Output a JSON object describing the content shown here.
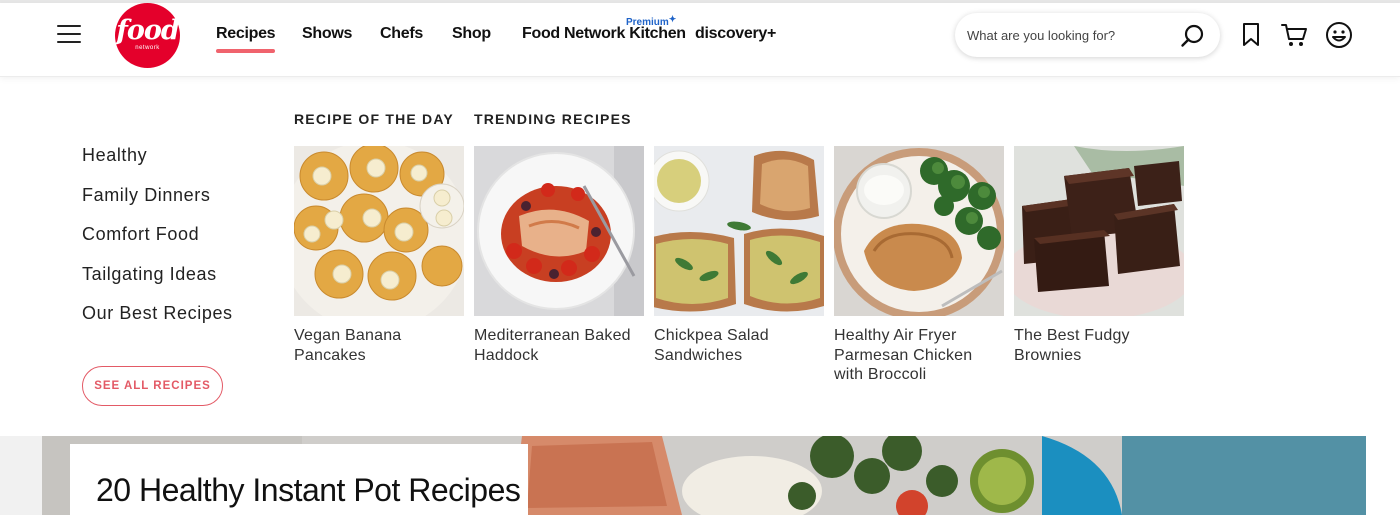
{
  "brand": {
    "logo_word": "food",
    "logo_sub": "network",
    "color": "#e4002b"
  },
  "nav": {
    "items": [
      {
        "label": "Recipes",
        "active": true
      },
      {
        "label": "Shows"
      },
      {
        "label": "Chefs"
      },
      {
        "label": "Shop"
      },
      {
        "label": "Food Network Kitchen"
      },
      {
        "label": "discovery+"
      }
    ],
    "premium_badge": "Premium",
    "active_underline_color": "#f0636d"
  },
  "search": {
    "placeholder": "What are you looking for?"
  },
  "icons": [
    "hamburger-icon",
    "search-icon",
    "bookmark-icon",
    "cart-icon",
    "profile-icon"
  ],
  "menu": {
    "categories": [
      "Healthy",
      "Family Dinners",
      "Comfort Food",
      "Tailgating Ideas",
      "Our Best Recipes"
    ],
    "see_all_label": "SEE ALL RECIPES",
    "recipe_of_the_day_heading": "RECIPE OF THE DAY",
    "trending_heading": "TRENDING RECIPES",
    "cards": [
      {
        "title": "Vegan Banana Pancakes"
      },
      {
        "title": "Mediterranean Baked Haddock"
      },
      {
        "title": "Chickpea Salad Sandwiches"
      },
      {
        "title": "Healthy Air Fryer Parmesan Chicken with Broccoli"
      },
      {
        "title": "The Best Fudgy Brownies"
      }
    ]
  },
  "hero": {
    "title": "20 Healthy Instant Pot Recipes"
  }
}
